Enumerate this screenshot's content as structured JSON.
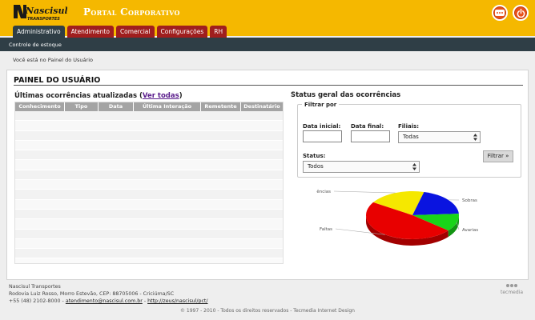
{
  "header": {
    "logo_text": "Nascisul",
    "logo_sub": "TRANSPORTES",
    "title": "Portal Corporativo"
  },
  "tabs": [
    {
      "label": "Administrativo",
      "active": true
    },
    {
      "label": "Atendimento",
      "active": false
    },
    {
      "label": "Comercial",
      "active": false
    },
    {
      "label": "Configurações",
      "active": false
    },
    {
      "label": "RH",
      "active": false
    }
  ],
  "subnav": {
    "item": "Controle de estoque"
  },
  "breadcrumb": "Você está no Painel do Usuário",
  "panel": {
    "title": "PAINEL DO USUÁRIO",
    "left_heading": "Últimas ocorrências atualizadas",
    "left_heading_link": "Ver todas",
    "table": {
      "columns": [
        "Conhecimento",
        "Tipo",
        "Data",
        "Última Interação",
        "Remetente",
        "Destinatário"
      ],
      "row_count": 15
    },
    "right_heading": "Status geral das ocorrências",
    "filter": {
      "legend": "Filtrar por",
      "data_inicial_label": "Data inicial:",
      "data_final_label": "Data final:",
      "filiais_label": "Filiais:",
      "filiais_value": "Todas",
      "status_label": "Status:",
      "status_value": "Todos",
      "button": "Filtrar »"
    }
  },
  "chart_data": {
    "type": "pie",
    "categories": [
      "Pendências",
      "Sobras",
      "Avarias",
      "Faltas"
    ],
    "values": [
      20,
      20,
      12,
      48
    ],
    "colors": [
      "#f5e800",
      "#0a14e0",
      "#19d419",
      "#e80000"
    ]
  },
  "footer": {
    "company": "Nascisul Transportes",
    "address": "Rodovia Luiz Rosso, Morro Estevão, CEP: 88705006 - Criciúma/SC",
    "phone": "+55 (48) 2102-8000 -",
    "email": "atendimento@nascisul.com.br",
    "separator": "-",
    "url": "http://zeus/nascisul/pct/",
    "copyright": "© 1997 - 2010 - Todos os direitos reservados - Tecmedia Internet Design",
    "brand": "tecmedia"
  }
}
